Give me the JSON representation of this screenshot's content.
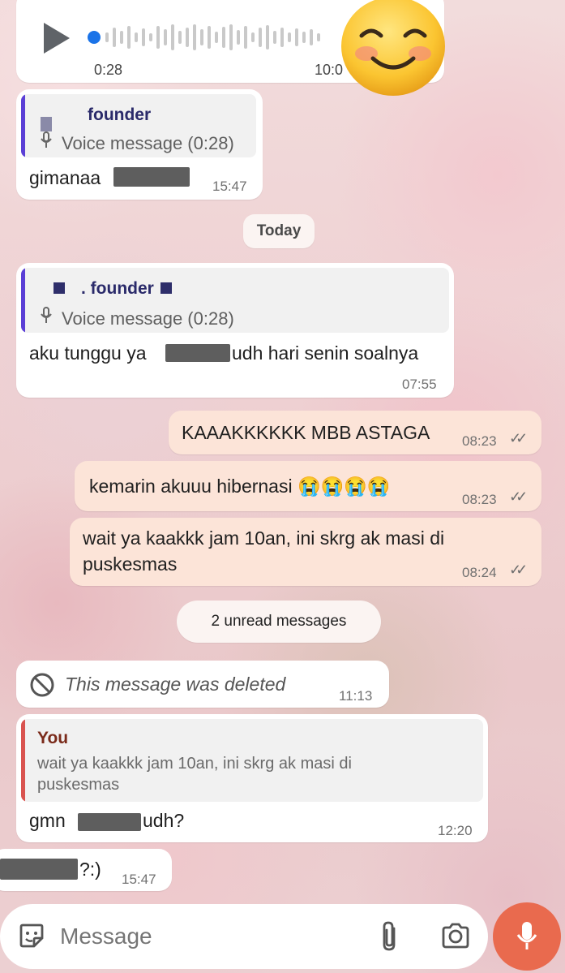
{
  "voice_top": {
    "duration": "0:28",
    "time": "10:0"
  },
  "msg1": {
    "quote_name": "founder",
    "quote_text": "Voice message (0:28)",
    "text": "gimanaa",
    "time": "15:47"
  },
  "date_chip": "Today",
  "msg2": {
    "quote_name": ". founder",
    "quote_text": "Voice message (0:28)",
    "text_before": "aku tunggu ya",
    "text_after": "udh hari senin soalnya",
    "time": "07:55"
  },
  "out1": {
    "text": "KAAAKKKKKK MBB ASTAGA",
    "time": "08:23"
  },
  "out2": {
    "text": "kemarin akuuu hibernasi 😭😭😭😭",
    "time": "08:23"
  },
  "out3": {
    "line1": "wait ya kaakkk jam 10an, ini skrg ak masi di",
    "line2": "puskesmas",
    "time": "08:24"
  },
  "unread_chip": "2 unread messages",
  "deleted": {
    "text": "This message was deleted",
    "time": "11:13"
  },
  "msg3": {
    "quote_name": "You",
    "quote_line1": "wait ya kaakkk jam 10an, ini skrg ak masi di",
    "quote_line2": "puskesmas",
    "text_before": "gmn",
    "text_after": "udh?",
    "time": "12:20"
  },
  "msg4": {
    "text": "?:)",
    "time": "15:47"
  },
  "composer": {
    "placeholder": "Message"
  },
  "colors": {
    "accent_quote": "#5b3fd6",
    "you_quote": "#d9534f",
    "mic_button": "#e96a4e"
  },
  "icons": [
    "play-icon",
    "mic-small-icon",
    "blocked-icon",
    "sticker-icon",
    "attach-icon",
    "camera-icon",
    "mic-icon",
    "smiley-sticker"
  ]
}
